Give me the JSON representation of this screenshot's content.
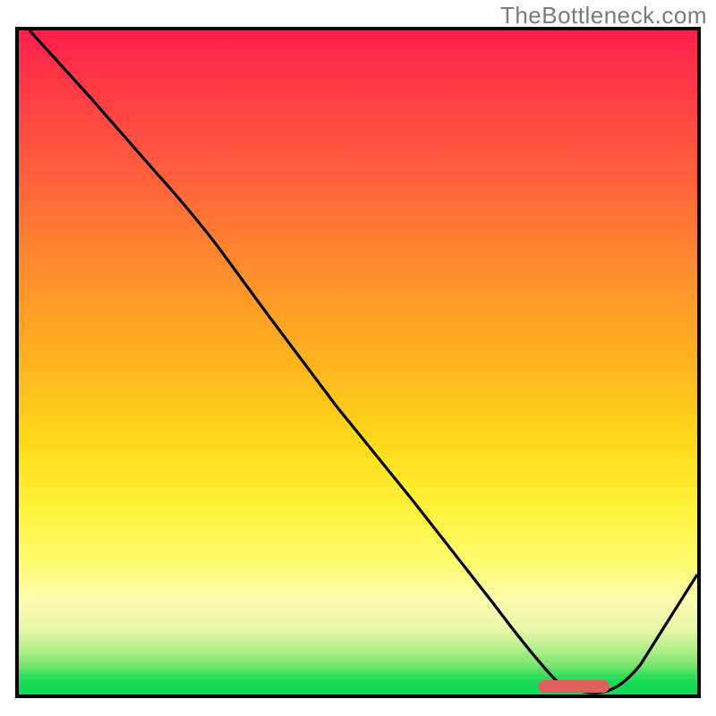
{
  "watermark": "TheBottleneck.com",
  "colors": {
    "frame": "#000000",
    "curve": "#000000",
    "marker": "#e0605e"
  },
  "chart_data": {
    "type": "line",
    "title": "",
    "xlabel": "",
    "ylabel": "",
    "xlim": [
      0,
      100
    ],
    "ylim": [
      0,
      100
    ],
    "grid": false,
    "series": [
      {
        "name": "curve",
        "x": [
          2,
          10,
          18,
          24,
          30,
          40,
          50,
          60,
          70,
          77,
          82,
          86,
          92,
          100
        ],
        "y": [
          100,
          90,
          80,
          73,
          67,
          54,
          41,
          28,
          14,
          3,
          0,
          0,
          8,
          19
        ]
      }
    ],
    "marker_band": {
      "x_start": 77,
      "x_end": 87,
      "y": 0.6
    },
    "gradient_stops": [
      {
        "pos": 0,
        "color": "#ff1f4b"
      },
      {
        "pos": 0.35,
        "color": "#ff8a2e"
      },
      {
        "pos": 0.62,
        "color": "#ffd91a"
      },
      {
        "pos": 0.86,
        "color": "#fdfbb0"
      },
      {
        "pos": 0.97,
        "color": "#3adf5e"
      },
      {
        "pos": 1.0,
        "color": "#0fd955"
      }
    ]
  }
}
